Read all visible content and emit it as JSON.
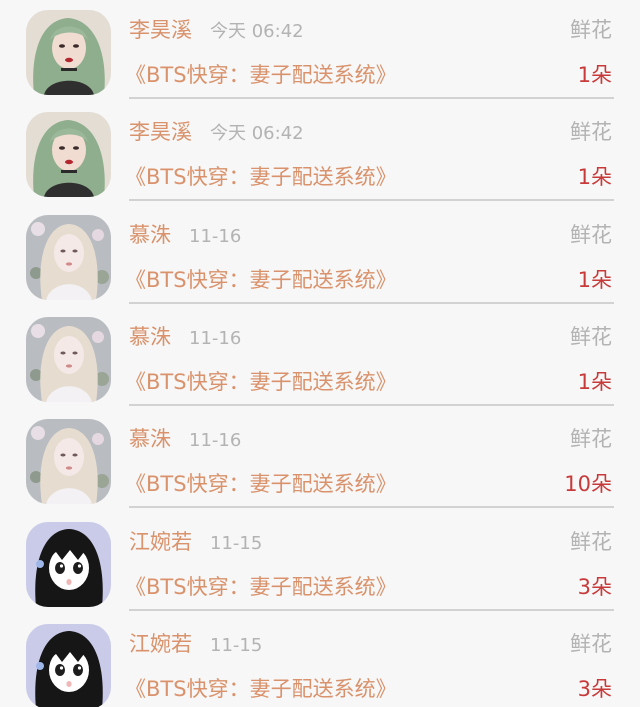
{
  "items": [
    {
      "name": "李昊溪",
      "time": "今天 06:42",
      "gift": "鲜花",
      "book": "《BTS快穿：妻子配送系统》",
      "count": "1朵",
      "avatar": "avatar-green-hair"
    },
    {
      "name": "李昊溪",
      "time": "今天 06:42",
      "gift": "鲜花",
      "book": "《BTS快穿：妻子配送系统》",
      "count": "1朵",
      "avatar": "avatar-green-hair"
    },
    {
      "name": "慕洙",
      "time": "11-16",
      "gift": "鲜花",
      "book": "《BTS快穿：妻子配送系统》",
      "count": "1朵",
      "avatar": "avatar-blonde-flowers"
    },
    {
      "name": "慕洙",
      "time": "11-16",
      "gift": "鲜花",
      "book": "《BTS快穿：妻子配送系统》",
      "count": "1朵",
      "avatar": "avatar-blonde-flowers"
    },
    {
      "name": "慕洙",
      "time": "11-16",
      "gift": "鲜花",
      "book": "《BTS快穿：妻子配送系统》",
      "count": "10朵",
      "avatar": "avatar-blonde-flowers"
    },
    {
      "name": "江婉若",
      "time": "11-15",
      "gift": "鲜花",
      "book": "《BTS快穿：妻子配送系统》",
      "count": "3朵",
      "avatar": "avatar-anime-girl"
    },
    {
      "name": "江婉若",
      "time": "11-15",
      "gift": "鲜花",
      "book": "《BTS快穿：妻子配送系统》",
      "count": "3朵",
      "avatar": "avatar-anime-girl"
    }
  ]
}
